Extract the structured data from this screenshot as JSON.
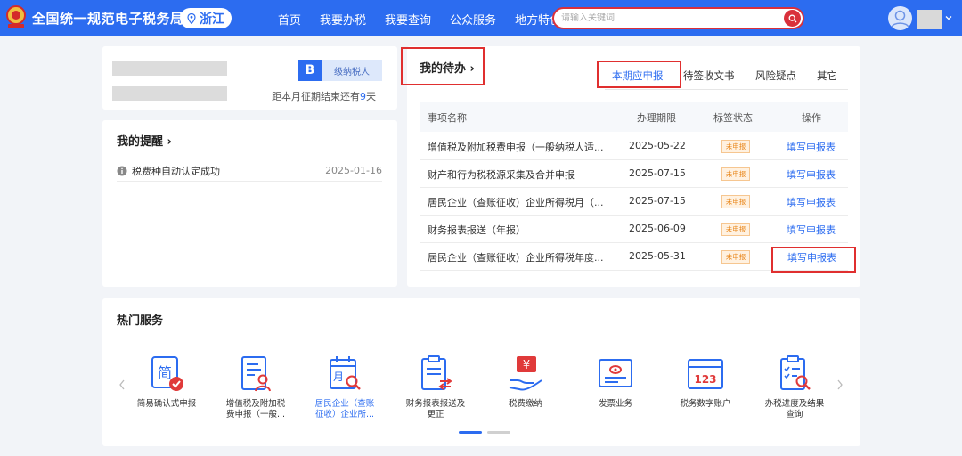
{
  "header": {
    "site_title": "全国统一规范电子税务局",
    "province": "浙江",
    "nav": [
      "首页",
      "我要办税",
      "我要查询",
      "公众服务",
      "地方特色"
    ],
    "search_placeholder": "请输入关键词",
    "brand_color": "#2c6cf0",
    "alert_color": "#d9303b"
  },
  "profile": {
    "credit_level": "B",
    "taxpayer_type": "级纳税人",
    "period_prefix": "距本月征期结束还有",
    "period_days": "9",
    "period_suffix": "天"
  },
  "reminders": {
    "title": "我的提醒",
    "items": [
      {
        "text": "税费种自动认定成功",
        "date": "2025-01-16"
      }
    ]
  },
  "todo": {
    "title": "我的待办",
    "tabs": [
      "本期应申报",
      "待签收文书",
      "风险疑点",
      "其它"
    ],
    "active_tab": "本期应申报",
    "columns": [
      "事项名称",
      "办理期限",
      "标签状态",
      "操作"
    ],
    "rows": [
      {
        "name": "增值税及附加税费申报（一般纳税人适...",
        "deadline": "2025-05-22",
        "status": "未申报",
        "action": "填写申报表"
      },
      {
        "name": "财产和行为税税源采集及合并申报",
        "deadline": "2025-07-15",
        "status": "未申报",
        "action": "填写申报表"
      },
      {
        "name": "居民企业（查账征收）企业所得税月（...",
        "deadline": "2025-07-15",
        "status": "未申报",
        "action": "填写申报表"
      },
      {
        "name": "财务报表报送（年报）",
        "deadline": "2025-06-09",
        "status": "未申报",
        "action": "填写申报表"
      },
      {
        "name": "居民企业（查账征收）企业所得税年度...",
        "deadline": "2025-05-31",
        "status": "未申报",
        "action": "填写申报表"
      }
    ]
  },
  "hot_services": {
    "title": "热门服务",
    "items": [
      {
        "icon": "simple-confirm-icon",
        "label_line1": "简易确认式申报",
        "label_line2": ""
      },
      {
        "icon": "vat-return-icon",
        "label_line1": "增值税及附加税",
        "label_line2": "费申报（一般..."
      },
      {
        "icon": "cit-calendar-icon",
        "label_line1": "居民企业（查账",
        "label_line2": "征收）企业所..."
      },
      {
        "icon": "financial-report-icon",
        "label_line1": "财务报表报送及",
        "label_line2": "更正"
      },
      {
        "icon": "tax-payment-icon",
        "label_line1": "税费缴纳",
        "label_line2": ""
      },
      {
        "icon": "invoice-icon",
        "label_line1": "发票业务",
        "label_line2": ""
      },
      {
        "icon": "digital-account-icon",
        "label_line1": "税务数字账户",
        "label_line2": ""
      },
      {
        "icon": "progress-query-icon",
        "label_line1": "办税进度及结果",
        "label_line2": "查询"
      }
    ]
  }
}
